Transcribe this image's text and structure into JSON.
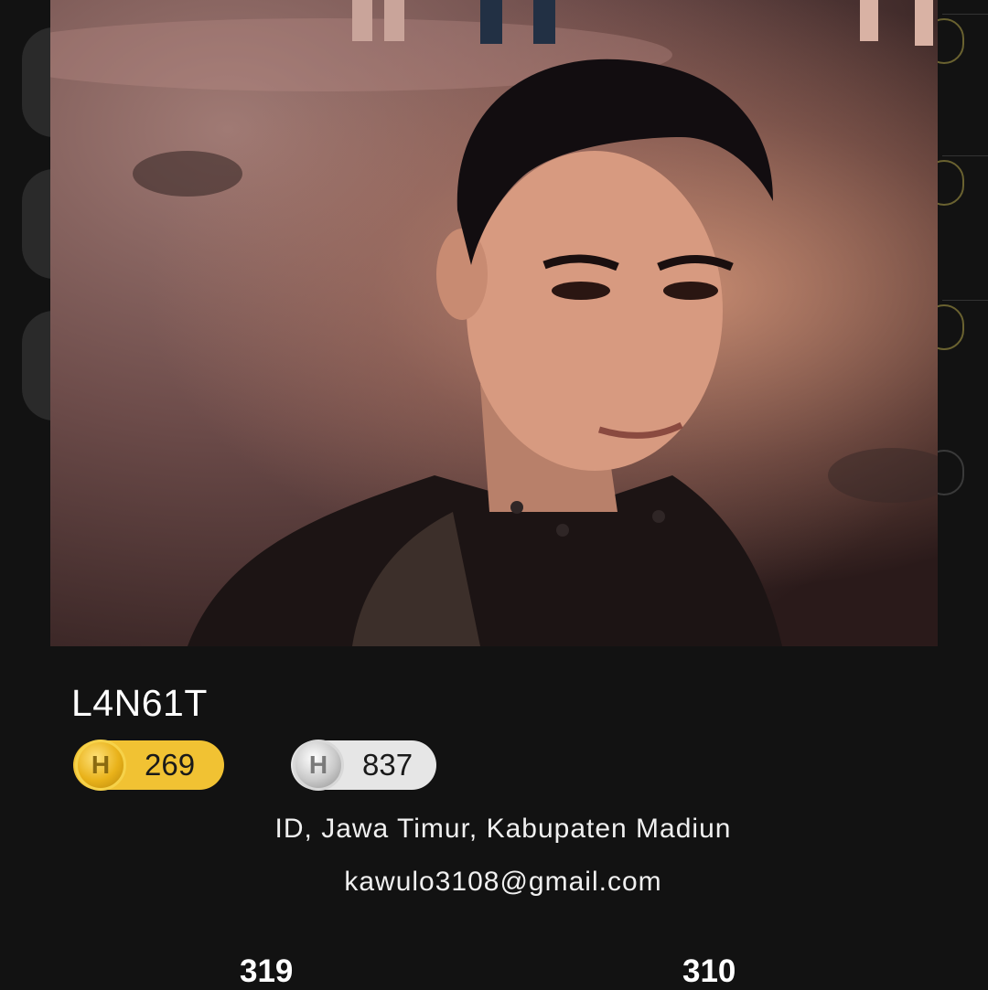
{
  "profile": {
    "username": "L4N61T",
    "gold_badge": {
      "icon_letter": "H",
      "count": "269",
      "color": "#f1c233"
    },
    "silver_badge": {
      "icon_letter": "H",
      "count": "837",
      "color": "#e6e6e6"
    },
    "location": "ID, Jawa Timur, Kabupaten Madiun",
    "email": "kawulo3108@gmail.com",
    "stats": {
      "left_value": "319",
      "right_value": "310"
    }
  }
}
